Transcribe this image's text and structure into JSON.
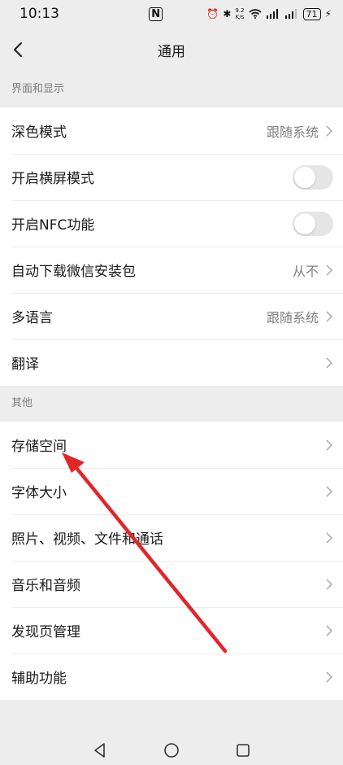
{
  "status_bar": {
    "time": "10:13",
    "nfc": "N",
    "net_speed_value": "9.2",
    "net_speed_unit": "K/s",
    "battery": "71"
  },
  "header": {
    "title": "通用",
    "back_icon": "chevron-left-icon"
  },
  "sections": [
    {
      "header": "界面和显示",
      "items": [
        {
          "label": "深色模式",
          "value": "跟随系统"
        },
        {
          "label": "开启横屏模式",
          "toggle": false
        },
        {
          "label": "开启NFC功能",
          "toggle": false
        },
        {
          "label": "自动下载微信安装包",
          "value": "从不"
        },
        {
          "label": "多语言",
          "value": "跟随系统"
        },
        {
          "label": "翻译",
          "value": ""
        }
      ]
    },
    {
      "header": "其他",
      "items": [
        {
          "label": "存储空间"
        },
        {
          "label": "字体大小"
        },
        {
          "label": "照片、视频、文件和通话"
        },
        {
          "label": "音乐和音频"
        },
        {
          "label": "发现页管理"
        },
        {
          "label": "辅助功能"
        }
      ]
    }
  ],
  "colors": {
    "background": "#ededed",
    "card": "#ffffff",
    "annotation_arrow": "#e0262a"
  }
}
